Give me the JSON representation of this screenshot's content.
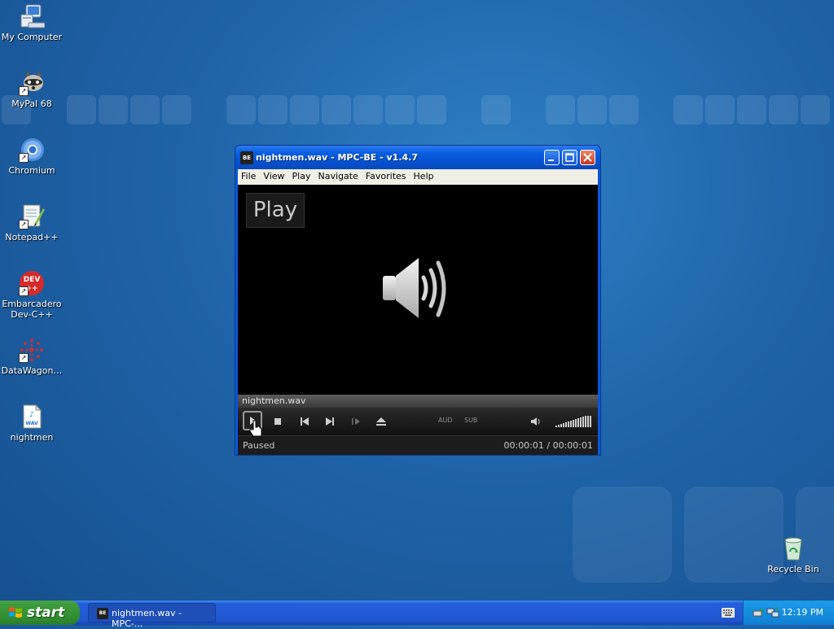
{
  "desktop": {
    "icons": [
      {
        "label": "My Computer",
        "icon": "my-computer-icon"
      },
      {
        "label": "MyPal 68",
        "icon": "mypal-icon"
      },
      {
        "label": "Chromium",
        "icon": "chromium-icon"
      },
      {
        "label": "Notepad++",
        "icon": "notepadpp-icon"
      },
      {
        "label": "Embarcadero Dev-C++",
        "icon": "devcpp-icon"
      },
      {
        "label": "DataWagon…",
        "icon": "datawagon-icon"
      },
      {
        "label": "nightmen",
        "icon": "wav-file-icon"
      },
      {
        "label": "Recycle Bin",
        "icon": "recycle-bin-icon"
      }
    ]
  },
  "window": {
    "title": "nightmen.wav - MPC-BE - v1.4.7",
    "app_icon_text": "BE",
    "menu": [
      "File",
      "View",
      "Play",
      "Navigate",
      "Favorites",
      "Help"
    ],
    "osd_text": "Play",
    "filename": "nightmen.wav",
    "controls": {
      "aud": "AUD",
      "sub": "SUB"
    },
    "status": "Paused",
    "time": "00:00:01 / 00:00:01"
  },
  "taskbar": {
    "start_label": "start",
    "task_item": "nightmen.wav - MPC-...",
    "clock": "12:19 PM"
  },
  "colors": {
    "desktop_bg": "#1f63a8",
    "title_blue": "#0551d0",
    "start_green": "#3c9a3c",
    "close_red": "#c8381c"
  }
}
